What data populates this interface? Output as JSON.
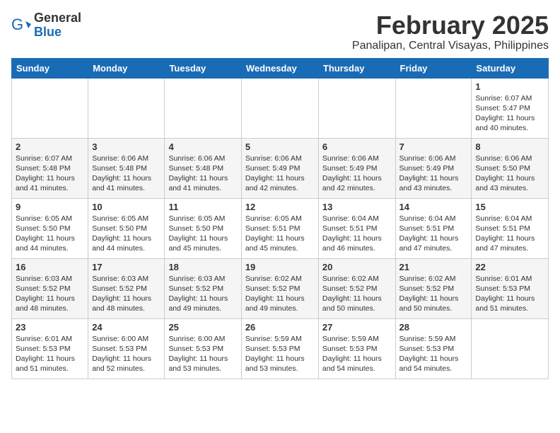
{
  "logo": {
    "text_general": "General",
    "text_blue": "Blue"
  },
  "header": {
    "month_year": "February 2025",
    "location": "Panalipan, Central Visayas, Philippines"
  },
  "days_of_week": [
    "Sunday",
    "Monday",
    "Tuesday",
    "Wednesday",
    "Thursday",
    "Friday",
    "Saturday"
  ],
  "weeks": [
    [
      {
        "day": "",
        "info": ""
      },
      {
        "day": "",
        "info": ""
      },
      {
        "day": "",
        "info": ""
      },
      {
        "day": "",
        "info": ""
      },
      {
        "day": "",
        "info": ""
      },
      {
        "day": "",
        "info": ""
      },
      {
        "day": "1",
        "info": "Sunrise: 6:07 AM\nSunset: 5:47 PM\nDaylight: 11 hours and 40 minutes."
      }
    ],
    [
      {
        "day": "2",
        "info": "Sunrise: 6:07 AM\nSunset: 5:48 PM\nDaylight: 11 hours and 41 minutes."
      },
      {
        "day": "3",
        "info": "Sunrise: 6:06 AM\nSunset: 5:48 PM\nDaylight: 11 hours and 41 minutes."
      },
      {
        "day": "4",
        "info": "Sunrise: 6:06 AM\nSunset: 5:48 PM\nDaylight: 11 hours and 41 minutes."
      },
      {
        "day": "5",
        "info": "Sunrise: 6:06 AM\nSunset: 5:49 PM\nDaylight: 11 hours and 42 minutes."
      },
      {
        "day": "6",
        "info": "Sunrise: 6:06 AM\nSunset: 5:49 PM\nDaylight: 11 hours and 42 minutes."
      },
      {
        "day": "7",
        "info": "Sunrise: 6:06 AM\nSunset: 5:49 PM\nDaylight: 11 hours and 43 minutes."
      },
      {
        "day": "8",
        "info": "Sunrise: 6:06 AM\nSunset: 5:50 PM\nDaylight: 11 hours and 43 minutes."
      }
    ],
    [
      {
        "day": "9",
        "info": "Sunrise: 6:05 AM\nSunset: 5:50 PM\nDaylight: 11 hours and 44 minutes."
      },
      {
        "day": "10",
        "info": "Sunrise: 6:05 AM\nSunset: 5:50 PM\nDaylight: 11 hours and 44 minutes."
      },
      {
        "day": "11",
        "info": "Sunrise: 6:05 AM\nSunset: 5:50 PM\nDaylight: 11 hours and 45 minutes."
      },
      {
        "day": "12",
        "info": "Sunrise: 6:05 AM\nSunset: 5:51 PM\nDaylight: 11 hours and 45 minutes."
      },
      {
        "day": "13",
        "info": "Sunrise: 6:04 AM\nSunset: 5:51 PM\nDaylight: 11 hours and 46 minutes."
      },
      {
        "day": "14",
        "info": "Sunrise: 6:04 AM\nSunset: 5:51 PM\nDaylight: 11 hours and 47 minutes."
      },
      {
        "day": "15",
        "info": "Sunrise: 6:04 AM\nSunset: 5:51 PM\nDaylight: 11 hours and 47 minutes."
      }
    ],
    [
      {
        "day": "16",
        "info": "Sunrise: 6:03 AM\nSunset: 5:52 PM\nDaylight: 11 hours and 48 minutes."
      },
      {
        "day": "17",
        "info": "Sunrise: 6:03 AM\nSunset: 5:52 PM\nDaylight: 11 hours and 48 minutes."
      },
      {
        "day": "18",
        "info": "Sunrise: 6:03 AM\nSunset: 5:52 PM\nDaylight: 11 hours and 49 minutes."
      },
      {
        "day": "19",
        "info": "Sunrise: 6:02 AM\nSunset: 5:52 PM\nDaylight: 11 hours and 49 minutes."
      },
      {
        "day": "20",
        "info": "Sunrise: 6:02 AM\nSunset: 5:52 PM\nDaylight: 11 hours and 50 minutes."
      },
      {
        "day": "21",
        "info": "Sunrise: 6:02 AM\nSunset: 5:52 PM\nDaylight: 11 hours and 50 minutes."
      },
      {
        "day": "22",
        "info": "Sunrise: 6:01 AM\nSunset: 5:53 PM\nDaylight: 11 hours and 51 minutes."
      }
    ],
    [
      {
        "day": "23",
        "info": "Sunrise: 6:01 AM\nSunset: 5:53 PM\nDaylight: 11 hours and 51 minutes."
      },
      {
        "day": "24",
        "info": "Sunrise: 6:00 AM\nSunset: 5:53 PM\nDaylight: 11 hours and 52 minutes."
      },
      {
        "day": "25",
        "info": "Sunrise: 6:00 AM\nSunset: 5:53 PM\nDaylight: 11 hours and 53 minutes."
      },
      {
        "day": "26",
        "info": "Sunrise: 5:59 AM\nSunset: 5:53 PM\nDaylight: 11 hours and 53 minutes."
      },
      {
        "day": "27",
        "info": "Sunrise: 5:59 AM\nSunset: 5:53 PM\nDaylight: 11 hours and 54 minutes."
      },
      {
        "day": "28",
        "info": "Sunrise: 5:59 AM\nSunset: 5:53 PM\nDaylight: 11 hours and 54 minutes."
      },
      {
        "day": "",
        "info": ""
      }
    ]
  ]
}
